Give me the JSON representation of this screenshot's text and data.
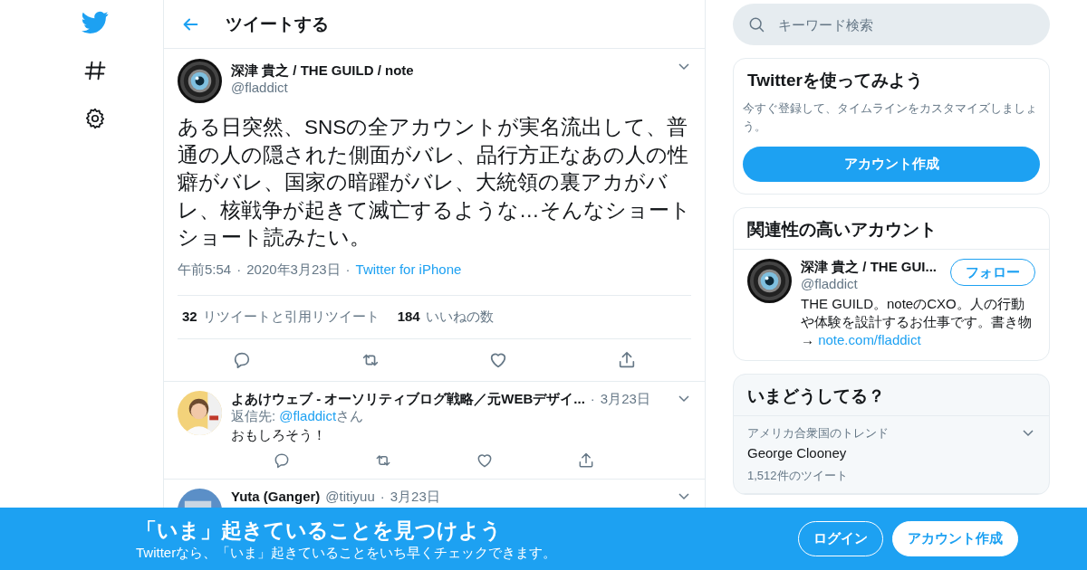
{
  "header": {
    "title": "ツイートする"
  },
  "tweet": {
    "name": "深津 貴之 / THE GUILD / note",
    "handle": "@fladdict",
    "text": "ある日突然、SNSの全アカウントが実名流出して、普通の人の隠された側面がバレ、品行方正なあの人の性癖がバレ、国家の暗躍がバレ、大統領の裏アカがバレ、核戦争が起きて滅亡するような…そんなショートショート読みたい。",
    "separator": "·",
    "time": "午前5:54",
    "date": "2020年3月23日",
    "source": "Twitter for iPhone",
    "retweet_count": "32",
    "retweet_label": "リツイートと引用リツイート",
    "like_count": "184",
    "like_label": "いいねの数"
  },
  "replies": [
    {
      "name": "よあけウェブ - オーソリティブログ戦略／元WEBデザイ...",
      "separator": "·",
      "date": "3月23日",
      "reply_prefix": "返信先:",
      "reply_handle": "@fladdict",
      "reply_suffix": "さん",
      "text": "おもしろそう！"
    },
    {
      "name": "Yuta (Ganger)",
      "handle": "@titiyuu",
      "separator": "·",
      "date": "3月23日"
    }
  ],
  "search": {
    "placeholder": "キーワード検索"
  },
  "signup_card": {
    "title": "Twitterを使ってみよう",
    "text": "今すぐ登録して、タイムラインをカスタマイズしましょう。",
    "button": "アカウント作成"
  },
  "related_card": {
    "title": "関連性の高いアカウント",
    "accounts": [
      {
        "name": "深津 貴之 / THE GUI...",
        "handle": "@fladdict",
        "follow": "フォロー",
        "bio": "THE GUILD。noteのCXO。人の行動や体験を設計するお仕事です。書き物 →",
        "link": "note.com/fladdict"
      }
    ]
  },
  "trends_card": {
    "title": "いまどうしてる？",
    "trends": [
      {
        "context": "アメリカ合衆国のトレンド",
        "name": "George Clooney",
        "count": "1,512件のツイート"
      }
    ]
  },
  "banner": {
    "title": "「いま」起きていることを見つけよう",
    "subtitle": "Twitterなら、「いま」起きていることをいち早くチェックできます。",
    "login": "ログイン",
    "signup": "アカウント作成"
  }
}
